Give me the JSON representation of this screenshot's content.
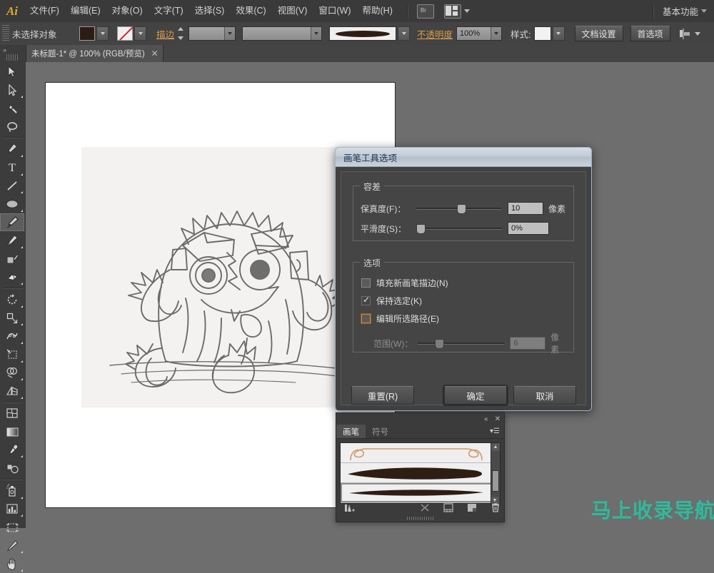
{
  "app": {
    "name": "Adobe Illustrator",
    "logo_text": "Ai"
  },
  "menubar": {
    "items": [
      {
        "label": "文件(F)",
        "name": "menu-file"
      },
      {
        "label": "编辑(E)",
        "name": "menu-edit"
      },
      {
        "label": "对象(O)",
        "name": "menu-object"
      },
      {
        "label": "文字(T)",
        "name": "menu-type"
      },
      {
        "label": "选择(S)",
        "name": "menu-select"
      },
      {
        "label": "效果(C)",
        "name": "menu-effect"
      },
      {
        "label": "视图(V)",
        "name": "menu-view"
      },
      {
        "label": "窗口(W)",
        "name": "menu-window"
      },
      {
        "label": "帮助(H)",
        "name": "menu-help"
      }
    ],
    "bridge_icon_label": "Br",
    "arrange_icon": "arrange-documents-icon",
    "workspace_label": "基本功能"
  },
  "controlbar": {
    "status_label": "未选择对象",
    "fill_swatch_color": "#2b1c14",
    "stroke_label": "描边",
    "stroke_none": true,
    "stroke_weight_value": "",
    "stroke_profile_value": "",
    "brush_definition_preview": "tapered-oval-brush",
    "opacity_label": "不透明度",
    "opacity_value": "100%",
    "style_label": "样式:",
    "document_setup_label": "文档设置",
    "preferences_label": "首选项",
    "separate_icon": "align-objects-icon"
  },
  "tabstrip": {
    "tab_title": "未标题-1* @ 100% (RGB/预览)",
    "close_glyph": "✕"
  },
  "toolbar": {
    "grip": "panel-grip",
    "collapse_glyph": "»",
    "tools": [
      {
        "name": "selection-tool",
        "label": "选择工具",
        "active": false,
        "flyout": false
      },
      {
        "name": "direct-selection-tool",
        "label": "直接选择工具",
        "active": false,
        "flyout": true
      },
      {
        "name": "magic-wand-tool",
        "label": "魔棒工具",
        "active": false,
        "flyout": false
      },
      {
        "name": "lasso-tool",
        "label": "套索工具",
        "active": false,
        "flyout": false
      },
      {
        "name": "pen-tool",
        "label": "钢笔工具",
        "active": false,
        "flyout": true
      },
      {
        "name": "type-tool",
        "label": "文字工具",
        "active": false,
        "flyout": true
      },
      {
        "name": "line-segment-tool",
        "label": "直线段工具",
        "active": false,
        "flyout": true
      },
      {
        "name": "ellipse-tool",
        "label": "椭圆工具",
        "active": false,
        "flyout": true
      },
      {
        "name": "paintbrush-tool",
        "label": "画笔工具",
        "active": true,
        "flyout": false
      },
      {
        "name": "pencil-tool",
        "label": "铅笔工具",
        "active": false,
        "flyout": true
      },
      {
        "name": "blob-brush-tool",
        "label": "斑点画笔工具",
        "active": false,
        "flyout": false
      },
      {
        "name": "eraser-tool",
        "label": "橡皮擦工具",
        "active": false,
        "flyout": true
      },
      {
        "name": "rotate-tool",
        "label": "旋转工具",
        "active": false,
        "flyout": true
      },
      {
        "name": "scale-tool",
        "label": "比例缩放工具",
        "active": false,
        "flyout": true
      },
      {
        "name": "width-tool",
        "label": "宽度工具",
        "active": false,
        "flyout": true
      },
      {
        "name": "free-transform-tool",
        "label": "自由变换工具",
        "active": false,
        "flyout": true
      },
      {
        "name": "shape-builder-tool",
        "label": "形状生成器工具",
        "active": false,
        "flyout": true
      },
      {
        "name": "perspective-grid-tool",
        "label": "透视网格工具",
        "active": false,
        "flyout": true
      },
      {
        "name": "mesh-tool",
        "label": "网格工具",
        "active": false,
        "flyout": false
      },
      {
        "name": "gradient-tool",
        "label": "渐变工具",
        "active": false,
        "flyout": false
      },
      {
        "name": "eyedropper-tool",
        "label": "吸管工具",
        "active": false,
        "flyout": true
      },
      {
        "name": "blend-tool",
        "label": "混合工具",
        "active": false,
        "flyout": true
      },
      {
        "name": "symbol-sprayer-tool",
        "label": "符号喷枪工具",
        "active": false,
        "flyout": true
      },
      {
        "name": "column-graph-tool",
        "label": "柱形图工具",
        "active": false,
        "flyout": true
      },
      {
        "name": "artboard-tool",
        "label": "画板工具",
        "active": false,
        "flyout": false
      },
      {
        "name": "slice-tool",
        "label": "切片工具",
        "active": false,
        "flyout": true
      },
      {
        "name": "hand-tool",
        "label": "抓手工具",
        "active": false,
        "flyout": true
      }
    ]
  },
  "canvas": {
    "artwork_name": "pencil-sketch-monster",
    "artwork_description": "铅笔手绘卡通怪物草图"
  },
  "dialog": {
    "title": "画笔工具选项",
    "tolerance_group_label": "容差",
    "fidelity_label": "保真度(F)：",
    "fidelity_value": "10",
    "fidelity_unit": "像素",
    "fidelity_percent": 52,
    "smoothness_label": "平滑度(S)：",
    "smoothness_value": "0%",
    "smoothness_percent": 0,
    "options_group_label": "选项",
    "checkboxes": [
      {
        "name": "fill-new-brush-strokes",
        "label": "填充新画笔描边(N)",
        "checked": false,
        "focused": false
      },
      {
        "name": "keep-selected",
        "label": "保持选定(K)",
        "checked": true,
        "focused": false
      },
      {
        "name": "edit-selected-paths",
        "label": "编辑所选路径(E)",
        "checked": false,
        "focused": true
      }
    ],
    "range_label": "范围(W)：",
    "range_value": "6",
    "range_unit": "像素",
    "range_percent": 22,
    "range_disabled": true,
    "reset_label": "重置(R)",
    "ok_label": "确定",
    "cancel_label": "取消"
  },
  "brushes_panel": {
    "collapse_glyph": "«",
    "close_glyph": "✕",
    "menu_glyph": "▾☰",
    "tabs": [
      {
        "label": "画笔",
        "name": "tab-brushes",
        "active": true
      },
      {
        "label": "符号",
        "name": "tab-symbols",
        "active": false
      }
    ],
    "items": [
      {
        "name": "brush-item-calligraphic-loop",
        "style": "loop",
        "selected": false
      },
      {
        "name": "brush-item-tapered-thick",
        "style": "thick",
        "selected": false
      },
      {
        "name": "brush-item-tapered-thin",
        "style": "thin",
        "selected": true
      }
    ],
    "scroll_up_glyph": "▲",
    "scroll_down_glyph": "▼",
    "footer_icons": [
      {
        "name": "brush-libraries-menu-icon"
      },
      {
        "name": "remove-brush-stroke-icon"
      },
      {
        "name": "options-of-selected-object-icon"
      },
      {
        "name": "new-brush-icon"
      },
      {
        "name": "delete-brush-icon"
      }
    ]
  },
  "watermark": {
    "text": "马上收录导航",
    "color": "#3fb39a"
  }
}
